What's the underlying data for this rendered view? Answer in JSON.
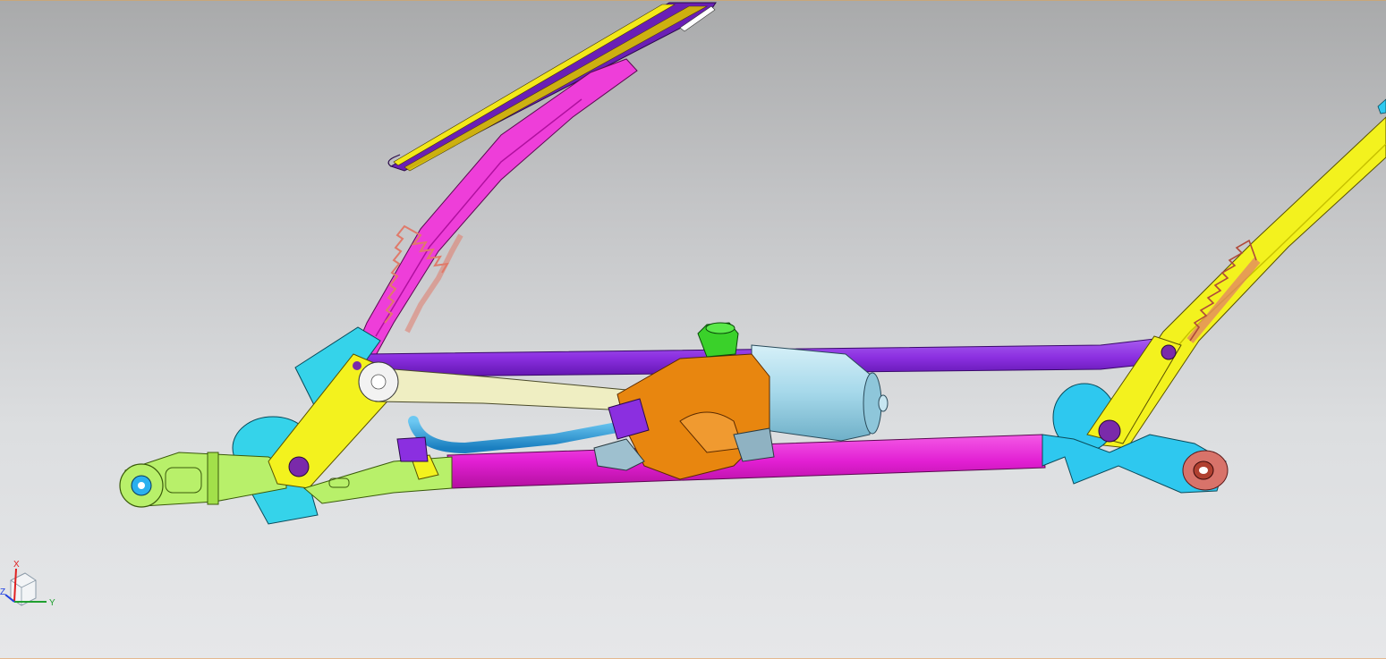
{
  "viewport": {
    "background_top": "#a9aaab",
    "background_bottom": "#e6e7e9"
  },
  "model": {
    "parts": [
      {
        "name": "left-wiper-blade",
        "color": "#6a1fb5"
      },
      {
        "name": "left-wiper-arm",
        "color": "#ee3ed9"
      },
      {
        "name": "right-wiper-arm",
        "color": "#f3f21e"
      },
      {
        "name": "upper-link-rod",
        "color": "#8b2fe0"
      },
      {
        "name": "lower-tube",
        "color": "#e21fd3"
      },
      {
        "name": "drive-crank",
        "color": "#efeec2"
      },
      {
        "name": "wiper-motor",
        "color": "#a5d8ea"
      },
      {
        "name": "gearbox-housing",
        "color": "#e8860f"
      },
      {
        "name": "connector-cap",
        "color": "#3ad12a"
      },
      {
        "name": "cable",
        "color": "#2aa3e0"
      },
      {
        "name": "left-pivot-bracket",
        "color": "#35d3ea"
      },
      {
        "name": "left-mount-bracket",
        "color": "#b8f06a"
      },
      {
        "name": "right-pivot-bracket",
        "color": "#2ec8ef"
      },
      {
        "name": "spring",
        "color": "#e07a6a"
      }
    ]
  },
  "triad": {
    "x_label": "X",
    "y_label": "Y",
    "z_label": "Z",
    "x_color": "#e02020",
    "y_color": "#20a030",
    "z_color": "#2040e0"
  }
}
